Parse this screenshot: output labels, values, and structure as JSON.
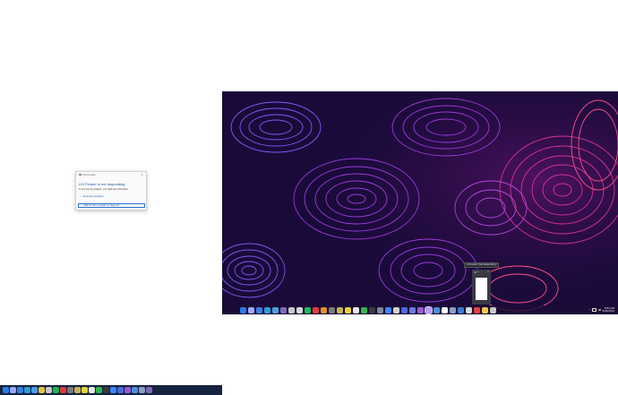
{
  "dialog": {
    "title": "LIS Fender",
    "heading": "LIS Fender is not responding",
    "body": "If you close the program, you might lose information.",
    "option_close": "Close the program",
    "option_wait": "Wait for the program to respond",
    "close_glyph": "✕"
  },
  "preview": {
    "tooltip": "LIS Fender (Not Responding)",
    "header_label": "Li",
    "close_glyph": "✕"
  },
  "taskbar2": {
    "tray_arrow": "^",
    "clock_time": "9:52 AM",
    "clock_date": "6/26/2024",
    "icon_colors": [
      "#2c7be5",
      "#9aa8ff",
      "#3b7ddd",
      "#2aa0d8",
      "#4a9fe0",
      "#7f6ab8",
      "#c9c9c9",
      "#d8d8d8",
      "#1db954",
      "#e23a3a",
      "#e0902a",
      "#7a7a7a",
      "#c8b15a",
      "#e6d23a",
      "#e8e8e8",
      "#2eb84f",
      "#3a3a3a",
      "#7a8a9a",
      "#3f86ff",
      "#d0d0d0",
      "#4a6ae0",
      "#6f7ad8",
      "#9c59d1",
      "#b79aff",
      "#4a90d9",
      "#ffffff",
      "#8aa0c8",
      "#3a7bd5",
      "#d8d8d8",
      "#e24040",
      "#f2c94c",
      "#c7c7c7"
    ],
    "active_index": 23
  },
  "taskbar1": {
    "icon_colors": [
      "#2c7be5",
      "#9aa8ff",
      "#3b7ddd",
      "#2aa0d8",
      "#4a9fe0",
      "#e6c24a",
      "#c9c9c9",
      "#1db954",
      "#e23a3a",
      "#7a7a7a",
      "#c8b15a",
      "#e6d23a",
      "#e8e8e8",
      "#2eb84f",
      "#3a3a3a",
      "#3f86ff",
      "#4a6ae0",
      "#9c59d1",
      "#4a90d9",
      "#8aa0c8",
      "#7f6ab8"
    ]
  }
}
